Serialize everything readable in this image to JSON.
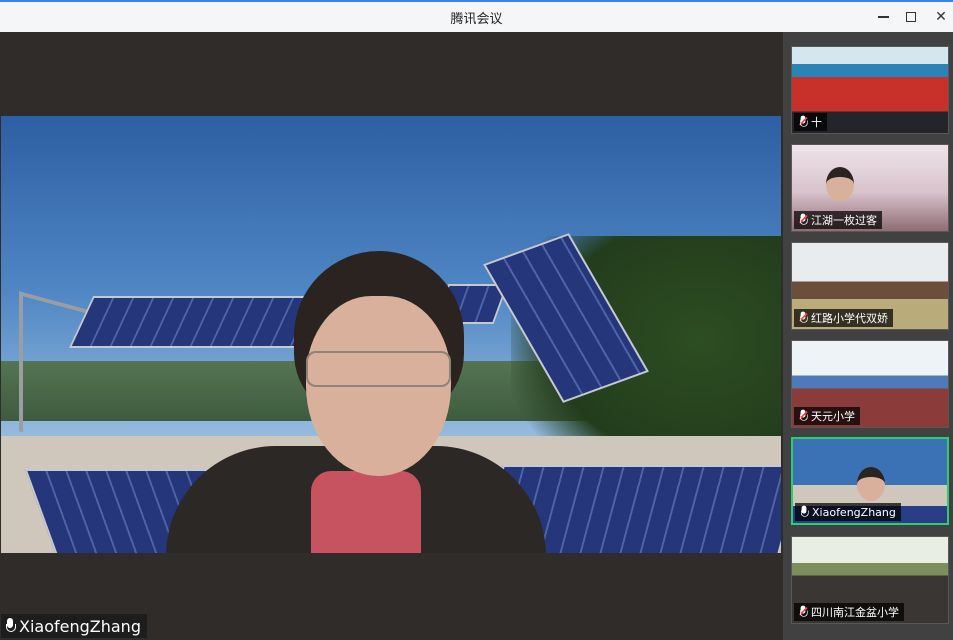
{
  "window": {
    "title": "腾讯会议",
    "controls": [
      "minimize",
      "maximize",
      "close"
    ]
  },
  "main_video": {
    "participant_name": "XiaofengZhang",
    "mic_state": "on"
  },
  "participants": [
    {
      "name": "十",
      "mic_state": "muted",
      "active": false
    },
    {
      "name": "江湖一枚过客",
      "mic_state": "muted",
      "active": false
    },
    {
      "name": "红路小学代双娇",
      "mic_state": "muted",
      "active": false
    },
    {
      "name": "天元小学",
      "mic_state": "muted",
      "active": false
    },
    {
      "name": "XiaofengZhang",
      "mic_state": "on",
      "active": true
    },
    {
      "name": "四川南江金盆小学",
      "mic_state": "muted",
      "active": false
    }
  ],
  "colors": {
    "active_border": "#2ecc71",
    "mute_slash": "#ff4040",
    "title_accent": "#3b82f6"
  }
}
